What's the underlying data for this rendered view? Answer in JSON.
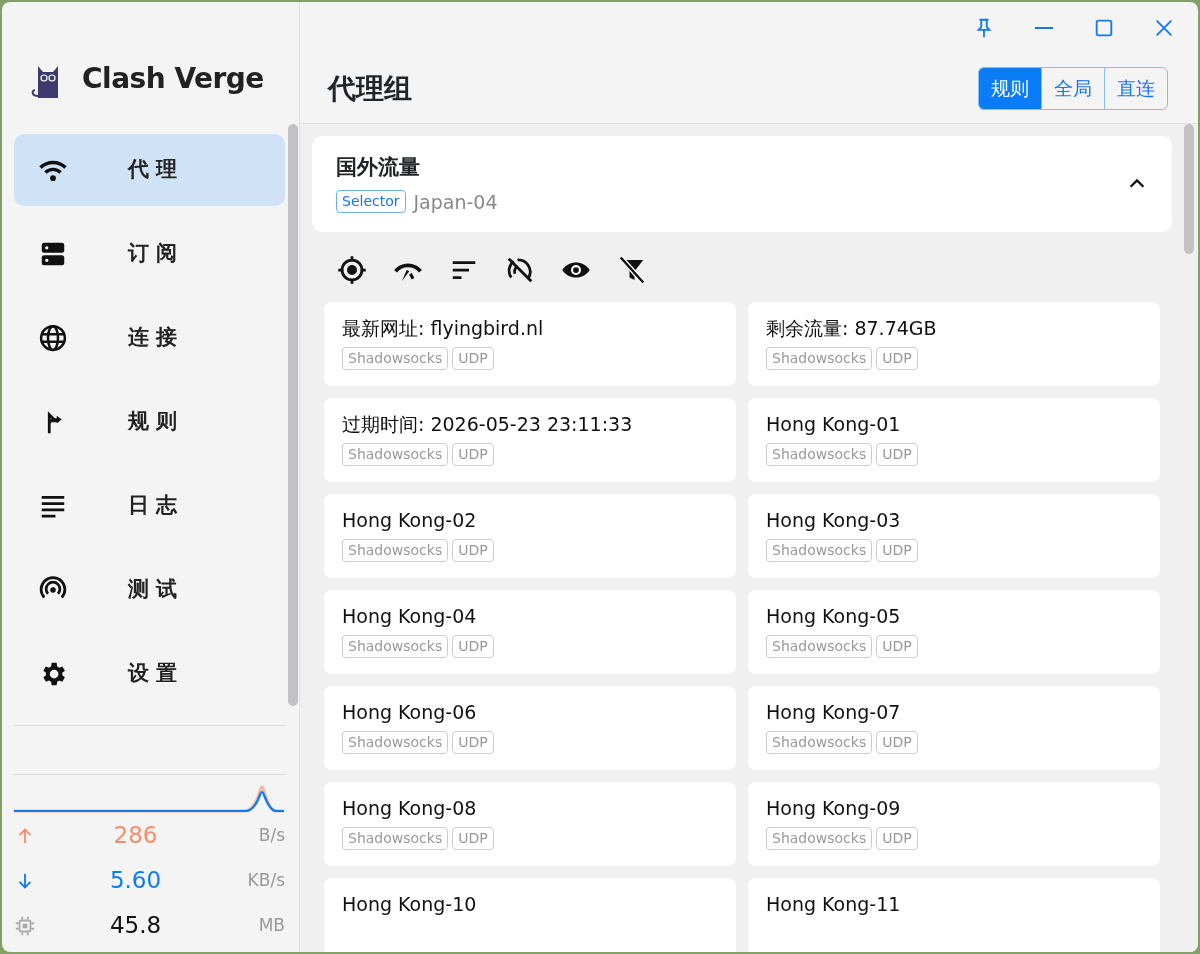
{
  "app": {
    "name": "Clash Verge"
  },
  "nav": [
    {
      "label": "代 理",
      "selected": true
    },
    {
      "label": "订 阅",
      "selected": false
    },
    {
      "label": "连 接",
      "selected": false
    },
    {
      "label": "规 则",
      "selected": false
    },
    {
      "label": "日 志",
      "selected": false
    },
    {
      "label": "测 试",
      "selected": false
    },
    {
      "label": "设 置",
      "selected": false
    }
  ],
  "traffic": {
    "stats": [
      {
        "kind": "up",
        "value": "286",
        "unit": "B/s"
      },
      {
        "kind": "down",
        "value": "5.60",
        "unit": "KB/s"
      },
      {
        "kind": "memory",
        "value": "45.8",
        "unit": "MB"
      }
    ]
  },
  "page": {
    "title": "代理组",
    "modes": [
      {
        "label": "规则",
        "selected": true
      },
      {
        "label": "全局",
        "selected": false
      },
      {
        "label": "直连",
        "selected": false
      }
    ]
  },
  "group": {
    "name": "国外流量",
    "type": "Selector",
    "current": "Japan-04",
    "expanded": true
  },
  "proxies": [
    {
      "name": "最新网址: flyingbird.nl",
      "tags": [
        "Shadowsocks",
        "UDP"
      ]
    },
    {
      "name": "剩余流量: 87.74GB",
      "tags": [
        "Shadowsocks",
        "UDP"
      ]
    },
    {
      "name": "过期时间: 2026-05-23 23:11:33",
      "tags": [
        "Shadowsocks",
        "UDP"
      ]
    },
    {
      "name": "Hong Kong-01",
      "tags": [
        "Shadowsocks",
        "UDP"
      ]
    },
    {
      "name": "Hong Kong-02",
      "tags": [
        "Shadowsocks",
        "UDP"
      ]
    },
    {
      "name": "Hong Kong-03",
      "tags": [
        "Shadowsocks",
        "UDP"
      ]
    },
    {
      "name": "Hong Kong-04",
      "tags": [
        "Shadowsocks",
        "UDP"
      ]
    },
    {
      "name": "Hong Kong-05",
      "tags": [
        "Shadowsocks",
        "UDP"
      ]
    },
    {
      "name": "Hong Kong-06",
      "tags": [
        "Shadowsocks",
        "UDP"
      ]
    },
    {
      "name": "Hong Kong-07",
      "tags": [
        "Shadowsocks",
        "UDP"
      ]
    },
    {
      "name": "Hong Kong-08",
      "tags": [
        "Shadowsocks",
        "UDP"
      ]
    },
    {
      "name": "Hong Kong-09",
      "tags": [
        "Shadowsocks",
        "UDP"
      ]
    },
    {
      "name": "Hong Kong-10"
    },
    {
      "name": "Hong Kong-11"
    }
  ]
}
